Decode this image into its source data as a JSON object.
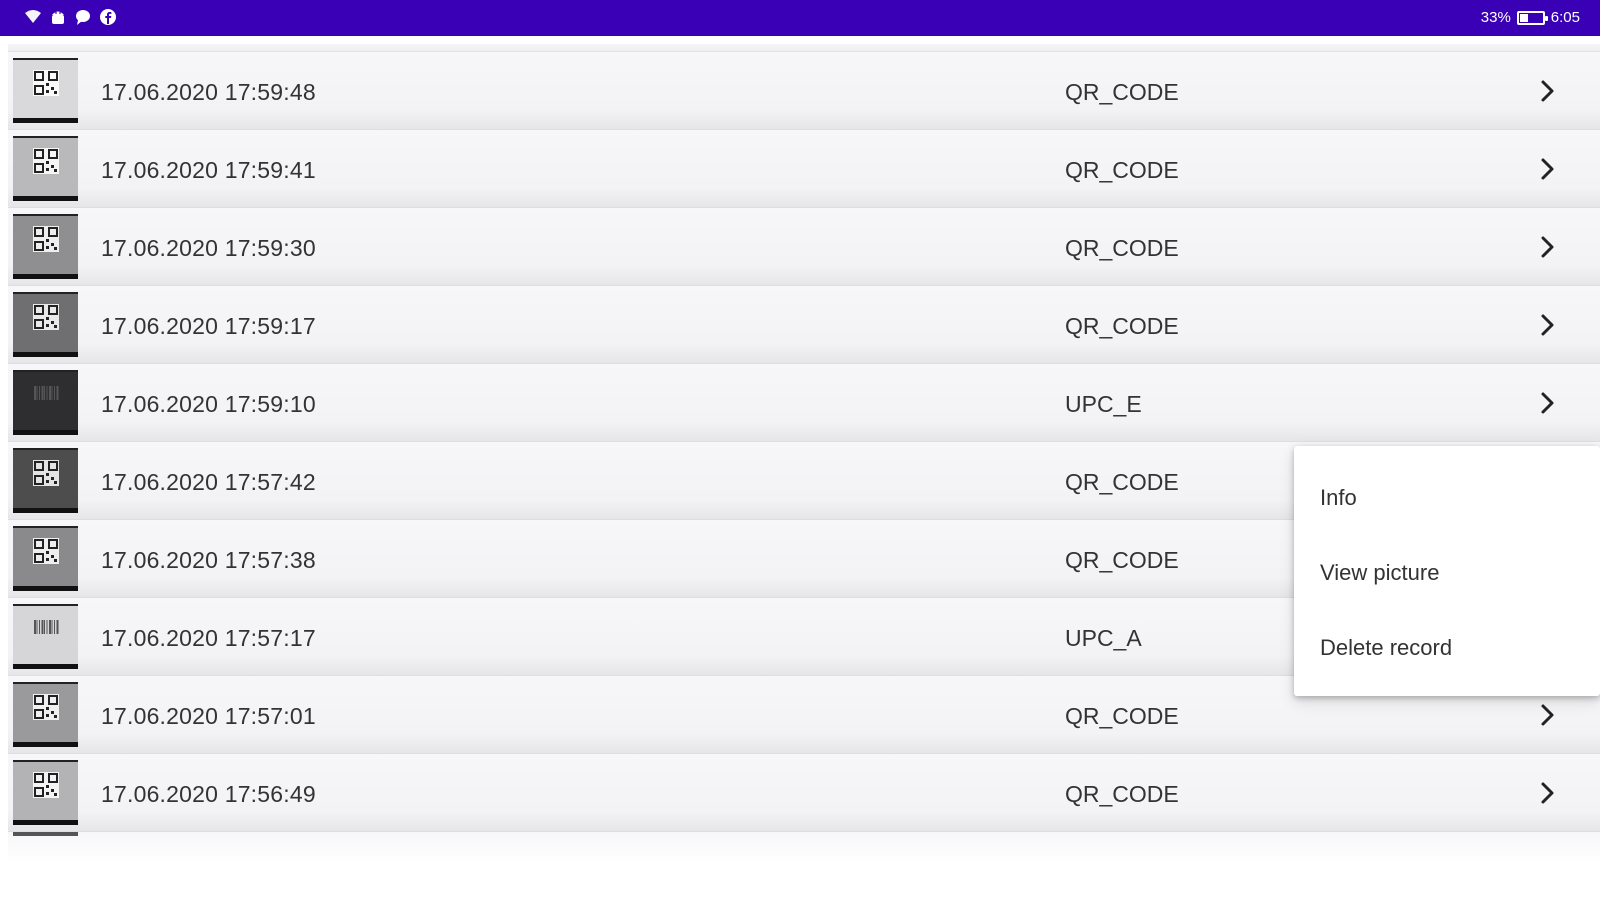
{
  "status_bar": {
    "icons": [
      "wifi-icon",
      "android-icon",
      "message-icon",
      "facebook-icon"
    ],
    "battery_percent_label": "33%",
    "battery_level": 0.33,
    "time": "6:05",
    "color": "#3a00b6"
  },
  "history": {
    "rows": [
      {
        "datetime": "17.06.2020  17:59:48",
        "type": "QR_CODE",
        "thumb_tone": "#d9d9db"
      },
      {
        "datetime": "17.06.2020  17:59:41",
        "type": "QR_CODE",
        "thumb_tone": "#b9b9bb"
      },
      {
        "datetime": "17.06.2020  17:59:30",
        "type": "QR_CODE",
        "thumb_tone": "#8f8f92"
      },
      {
        "datetime": "17.06.2020  17:59:17",
        "type": "QR_CODE",
        "thumb_tone": "#6f6f72"
      },
      {
        "datetime": "17.06.2020  17:59:10",
        "type": "UPC_E",
        "thumb_tone": "#2e2e30"
      },
      {
        "datetime": "17.06.2020  17:57:42",
        "type": "QR_CODE",
        "thumb_tone": "#4d4d4d"
      },
      {
        "datetime": "17.06.2020  17:57:38",
        "type": "QR_CODE",
        "thumb_tone": "#8a8a8c"
      },
      {
        "datetime": "17.06.2020  17:57:17",
        "type": "UPC_A",
        "thumb_tone": "#d6d6d8"
      },
      {
        "datetime": "17.06.2020  17:57:01",
        "type": "QR_CODE",
        "thumb_tone": "#9a9a9c"
      },
      {
        "datetime": "17.06.2020  17:56:49",
        "type": "QR_CODE",
        "thumb_tone": "#b3b3b5"
      }
    ]
  },
  "context_menu": {
    "items": [
      "Info",
      "View picture",
      "Delete record"
    ]
  },
  "colors": {
    "text": "#333333",
    "row_bg": "#f4f3f5",
    "menu_bg": "#ffffff"
  }
}
